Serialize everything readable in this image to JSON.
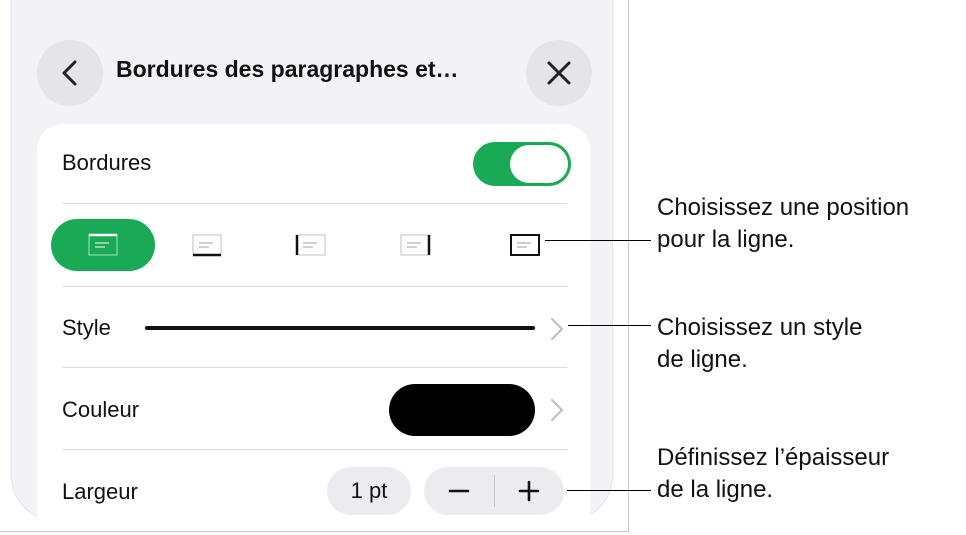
{
  "header": {
    "title": "Bordures des paragraphes et…",
    "back_icon": "chevron-left-icon",
    "close_icon": "close-icon"
  },
  "borders": {
    "label": "Bordures",
    "enabled": true,
    "positions": [
      {
        "id": "top",
        "icon": "border-top-icon",
        "selected": true
      },
      {
        "id": "bottom",
        "icon": "border-bottom-icon",
        "selected": false
      },
      {
        "id": "left",
        "icon": "border-left-icon",
        "selected": false
      },
      {
        "id": "right",
        "icon": "border-right-icon",
        "selected": false
      },
      {
        "id": "box",
        "icon": "border-box-icon",
        "selected": false
      }
    ]
  },
  "style": {
    "label": "Style"
  },
  "color": {
    "label": "Couleur",
    "value": "#000000"
  },
  "width": {
    "label": "Largeur",
    "value": "1 pt",
    "minus": "−",
    "plus": "+"
  },
  "callouts": [
    {
      "text": "Choisissez une position\npour la ligne."
    },
    {
      "text": "Choisissez un style\nde ligne."
    },
    {
      "text": "Définissez l’épaisseur\nde la ligne."
    }
  ],
  "colors": {
    "accent": "#1aaa55",
    "panel": "#f2f2f7",
    "card": "#ffffff"
  }
}
